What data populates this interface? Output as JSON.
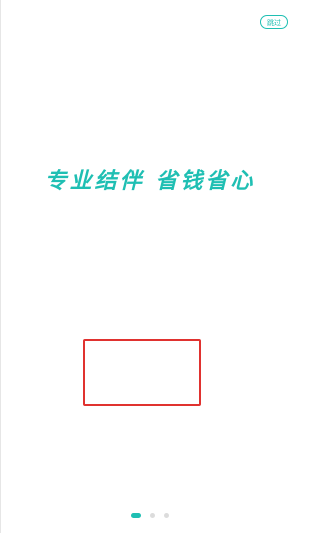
{
  "header": {
    "skip_label": "跳过"
  },
  "main": {
    "slogan": "专业结伴 省钱省心"
  },
  "pager": {
    "total_pages": 3,
    "current_page": 1
  },
  "colors": {
    "accent": "#1fbfb3",
    "highlight_border": "#e0322f",
    "inactive_dot": "#dcdcdc"
  }
}
